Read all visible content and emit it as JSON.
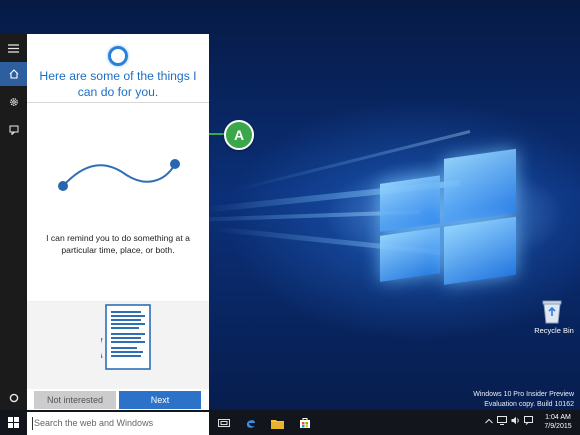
{
  "cortana": {
    "headline": "Here are some of the things I can do for you.",
    "reminder_text": "I can remind you to do something at a particular time, place, or both.",
    "buttons": {
      "not_interested": "Not interested",
      "next": "Next"
    }
  },
  "taskbar": {
    "search_placeholder": "Search the web and Windows",
    "clock": {
      "time": "1:04 AM",
      "date": "7/9/2015"
    }
  },
  "desktop": {
    "watermark_line1": "Windows 10 Pro Insider Preview",
    "watermark_line2": "Evaluation copy. Build 10162",
    "recycle_bin_label": "Recycle Bin"
  },
  "callout": {
    "label": "A"
  },
  "colors": {
    "accent": "#2d72c9",
    "cortana_text": "#1e6fc4",
    "callout": "#3aa84a"
  },
  "icons": [
    "hamburger-icon",
    "home-icon",
    "gear-icon",
    "feedback-icon",
    "cortana-ring-icon",
    "windows-start-icon",
    "task-view-icon",
    "edge-icon",
    "file-explorer-icon",
    "store-icon",
    "chevron-up-icon",
    "network-icon",
    "volume-icon",
    "notification-icon"
  ]
}
